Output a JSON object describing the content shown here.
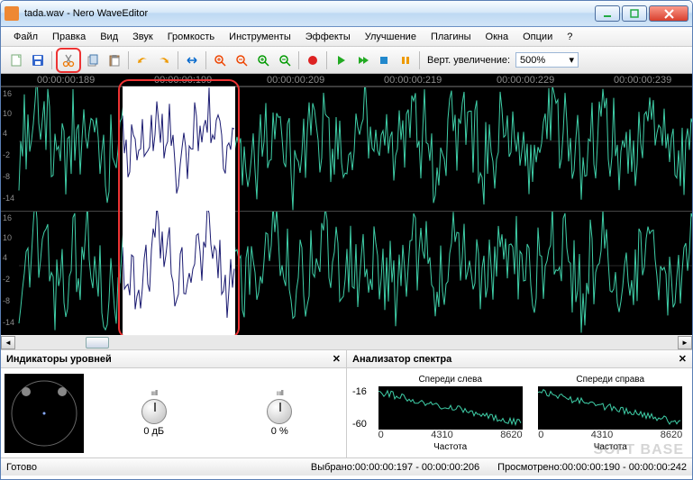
{
  "title": "tada.wav - Nero WaveEditor",
  "menu": [
    "Файл",
    "Правка",
    "Вид",
    "Звук",
    "Громкость",
    "Инструменты",
    "Эффекты",
    "Улучшение",
    "Плагины",
    "Окна",
    "Опции",
    "?"
  ],
  "toolbar": {
    "zoom_label": "Верт. увеличение:",
    "zoom_value": "500%"
  },
  "ruler": {
    "t0": "00:00:00:189",
    "t1": "00:00:00:199",
    "t2": "00:00:00:209",
    "t3": "00:00:00:219",
    "t4": "00:00:00:229",
    "t5": "00:00:00:239"
  },
  "yticks": [
    "16",
    "10",
    "4",
    "-2",
    "-8",
    "-14"
  ],
  "panels": {
    "levels_title": "Индикаторы уровней",
    "spectrum_title": "Анализатор спектра",
    "db": "0 дБ",
    "pct": "0 %",
    "front_left": "Спереди слева",
    "front_right": "Спереди справа",
    "y_minus16": "-16",
    "y_minus60": "-60",
    "x0": "0",
    "x1": "4310",
    "x2": "8620",
    "freq": "Частота"
  },
  "status": {
    "ready": "Готово",
    "selected": "Выбрано:00:00:00:197 - 00:00:00:206",
    "viewed": "Просмотрено:00:00:00:190 - 00:00:00:242"
  },
  "watermark": "SOFT BASE"
}
